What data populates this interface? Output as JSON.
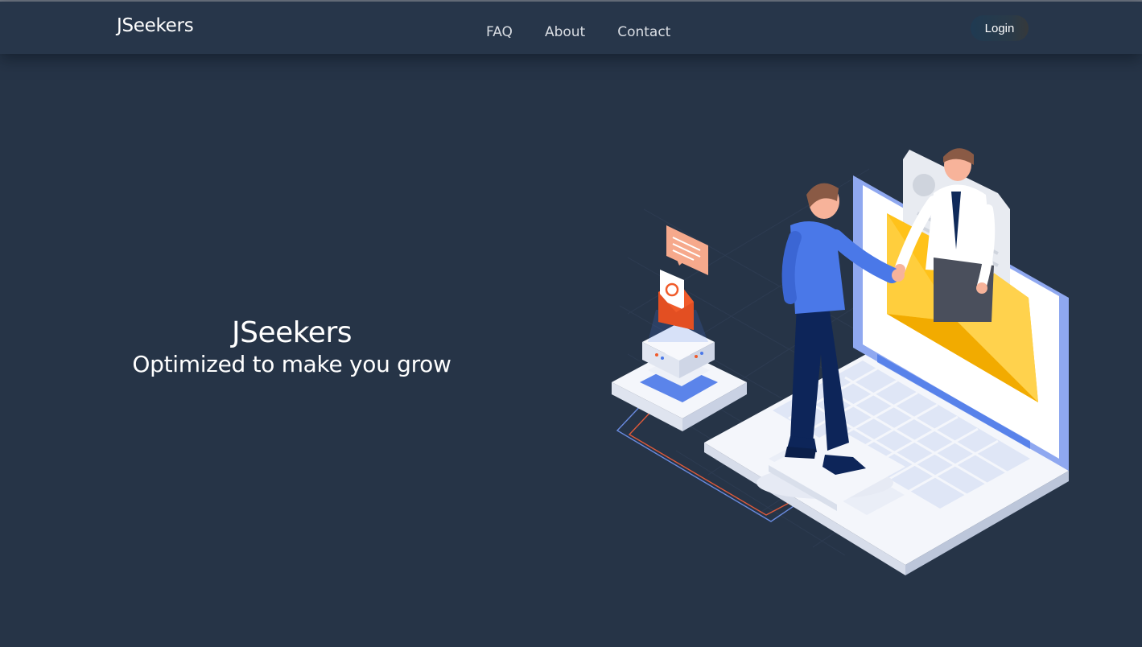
{
  "header": {
    "brand": "JSeekers",
    "nav": [
      {
        "label": "FAQ"
      },
      {
        "label": "About"
      },
      {
        "label": "Contact"
      }
    ],
    "login_label": "Login"
  },
  "hero": {
    "title": "JSeekers",
    "subtitle": "Optimized to make you grow"
  },
  "colors": {
    "background": "#263447",
    "navbar": "#27364a",
    "text": "#ffffff",
    "accent_blue": "#4a78e8",
    "accent_yellow": "#ffc21a",
    "accent_orange": "#f05b2a"
  }
}
